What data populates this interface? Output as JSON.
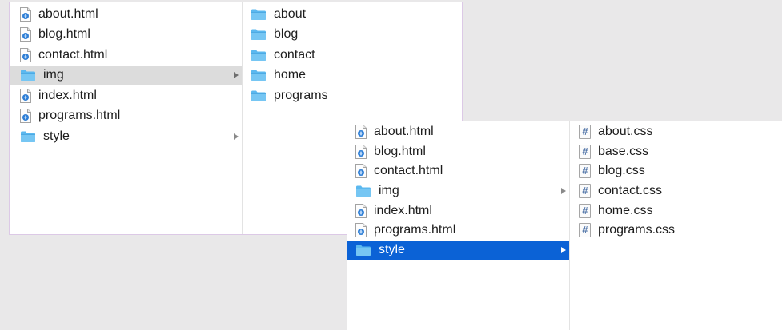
{
  "window1": {
    "column1": [
      {
        "name": "about.html",
        "icon": "html-file-icon"
      },
      {
        "name": "blog.html",
        "icon": "html-file-icon"
      },
      {
        "name": "contact.html",
        "icon": "html-file-icon"
      },
      {
        "name": "img",
        "icon": "folder-icon",
        "has_children": true,
        "selected": "inactive"
      },
      {
        "name": "index.html",
        "icon": "html-file-icon"
      },
      {
        "name": "programs.html",
        "icon": "html-file-icon"
      },
      {
        "name": "style",
        "icon": "folder-icon",
        "has_children": true
      }
    ],
    "column2": [
      {
        "name": "about",
        "icon": "folder-icon"
      },
      {
        "name": "blog",
        "icon": "folder-icon"
      },
      {
        "name": "contact",
        "icon": "folder-icon"
      },
      {
        "name": "home",
        "icon": "folder-icon"
      },
      {
        "name": "programs",
        "icon": "folder-icon"
      }
    ]
  },
  "window2": {
    "column1": [
      {
        "name": "about.html",
        "icon": "html-file-icon"
      },
      {
        "name": "blog.html",
        "icon": "html-file-icon"
      },
      {
        "name": "contact.html",
        "icon": "html-file-icon"
      },
      {
        "name": "img",
        "icon": "folder-icon",
        "has_children": true
      },
      {
        "name": "index.html",
        "icon": "html-file-icon"
      },
      {
        "name": "programs.html",
        "icon": "html-file-icon"
      },
      {
        "name": "style",
        "icon": "folder-icon",
        "has_children": true,
        "selected": "active"
      }
    ],
    "column2": [
      {
        "name": "about.css",
        "icon": "css-file-icon"
      },
      {
        "name": "base.css",
        "icon": "css-file-icon"
      },
      {
        "name": "blog.css",
        "icon": "css-file-icon"
      },
      {
        "name": "contact.css",
        "icon": "css-file-icon"
      },
      {
        "name": "home.css",
        "icon": "css-file-icon"
      },
      {
        "name": "programs.css",
        "icon": "css-file-icon"
      }
    ]
  },
  "colors": {
    "selection_active": "#0b62d6",
    "selection_inactive": "#dcdcdc",
    "folder": "#5bb8ef"
  }
}
